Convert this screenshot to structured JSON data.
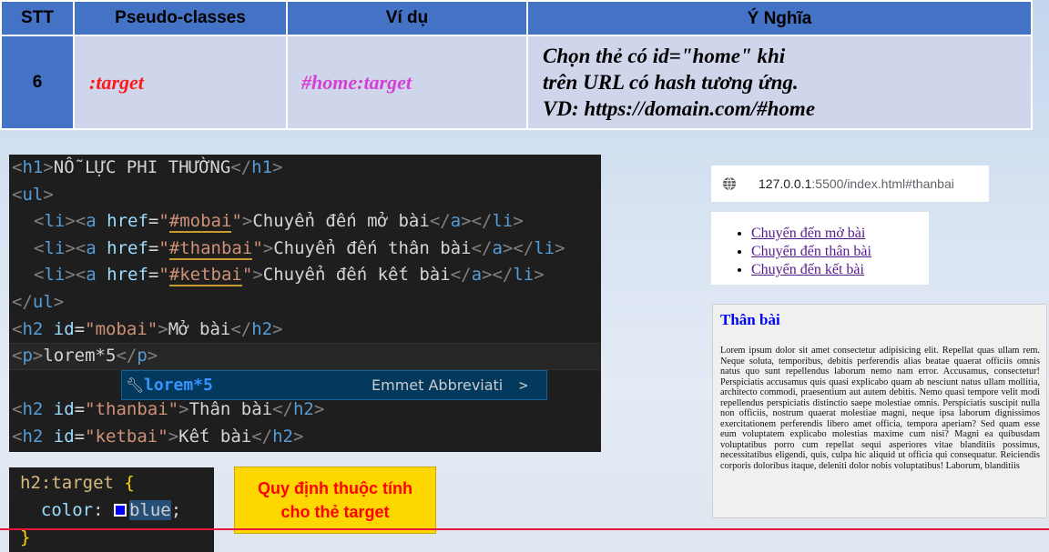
{
  "table": {
    "headers": [
      "STT",
      "Pseudo-classes",
      "Ví dụ",
      "Ý Nghĩa"
    ],
    "row": {
      "stt": "6",
      "pseudo_class": ":target",
      "example": "#home:target",
      "meaning": [
        "Chọn thẻ có id=\"home\" khi",
        "trên URL có hash tương ứng.",
        "VD: https://domain.com/#home"
      ]
    }
  },
  "editor": {
    "h1_text": "NỖ LỰC PHI THƯỜNG",
    "links": [
      {
        "href": "#mobai",
        "text": "Chuyển đến mở bài"
      },
      {
        "href": "#thanbai",
        "text": "Chuyển đến thân bài"
      },
      {
        "href": "#ketbai",
        "text": "Chuyển đến kết bài"
      }
    ],
    "h2_mobai": {
      "id": "mobai",
      "text": "Mở bài"
    },
    "p_text": "lorem*5",
    "h2_thanbai": {
      "id": "thanbai",
      "text": "Thân bài"
    },
    "h2_ketbai": {
      "id": "ketbai",
      "text": "Kết bài"
    },
    "suggestion": {
      "label": "lorem*5",
      "detail": "Emmet Abbreviati",
      "more_icon": ">"
    }
  },
  "css_snippet": {
    "selector": "h2:target",
    "property": "color",
    "value": "blue",
    "color_swatch": "#0000ff"
  },
  "note": {
    "line1": "Quy định thuộc tính",
    "line2": "cho thẻ target"
  },
  "browser": {
    "url_host": "127.0.0.1",
    "url_rest": ":5500/index.html#thanbai",
    "list": [
      "Chuyển đến mở bài",
      "Chuyển đến thân bài",
      "Chuyển đến kết bài"
    ],
    "heading": "Thân bài",
    "heading_color": "#0000ff",
    "paragraph": "Lorem ipsum dolor sit amet consectetur adipisicing elit. Repellat quas ullam rem. Neque soluta, temporibus, debitis perferendis alias beatae quaerat officiis omnis natus quo sunt repellendus laborum nemo nam error. Accusamus, consectetur! Perspiciatis accusamus quis quasi explicabo quam ab nesciunt natus ullam mollitia, architecto commodi, praesentium aut autem debitis. Nemo quasi tempore velit modi repellendus perspiciatis distinctio saepe molestiae omnis. Perspiciatis suscipit nulla non officiis, nostrum quaerat molestiae magni, neque ipsa laborum dignissimos exercitationem perferendis libero amet officia, tempora aperiam? Sed quam esse eum voluptatem explicabo molestias maxime cum nisi? Magni ea quibusdam voluptatibus porro cum repellat sequi asperiores vitae blanditiis possimus, necessitatibus eligendi, quis, culpa hic aliquid ut officia qui consequatur. Reiciendis corporis doloribus itaque, deleniti dolor nobis voluptatibus! Laborum, blanditiis"
  },
  "colors": {
    "header_blue": "#4472c4",
    "cell_bg": "#cfd5ea",
    "pseudo_red": "#ff1a1a",
    "example_magenta": "#d53fd5",
    "note_yellow": "#ffd700",
    "divider_red": "#e8163b"
  }
}
